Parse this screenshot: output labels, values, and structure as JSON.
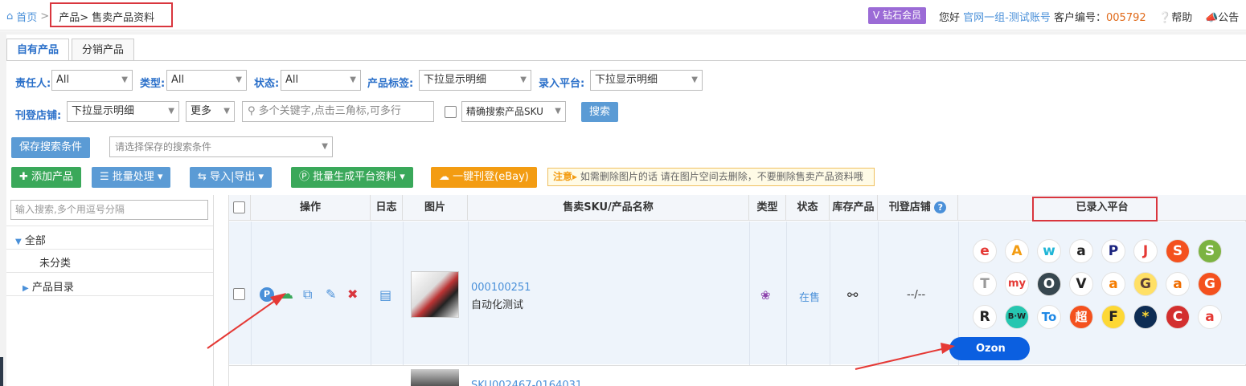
{
  "breadcrumb": {
    "home": "首页",
    "sep": ">",
    "product": "产品>",
    "current": "售卖产品资料"
  },
  "header": {
    "vip": "钻石会员",
    "greet": "您好",
    "account": "官网一组-测试账号",
    "customer_label": "客户编号：",
    "customer_no": "005792",
    "help": "帮助",
    "notice": "公告"
  },
  "tabs": [
    "自有产品",
    "分销产品"
  ],
  "filters": {
    "owner_label": "责任人:",
    "owner_value": "All",
    "type_label": "类型:",
    "type_value": "All",
    "status_label": "状态:",
    "status_value": "All",
    "tag_label": "产品标签:",
    "tag_value": "下拉显示明细",
    "platform_label": "录入平台:",
    "platform_value": "下拉显示明细",
    "shop_label": "刊登店铺:",
    "shop_value": "下拉显示明细",
    "more_value": "更多",
    "keyword_placeholder": "多个关键字,点击三角标,可多行",
    "exact_label": "精确搜索产品SKU",
    "search_button": "搜索",
    "save_button": "保存搜索条件",
    "saved_placeholder": "请选择保存的搜索条件"
  },
  "toolbar": {
    "add": "添加产品",
    "batch": "批量处理",
    "io": "导入|导出",
    "gen": "批量生成平台资料",
    "publish": "一键刊登(eBay)",
    "tip_label": "注意",
    "tip_text": "如需删除图片的话 请在图片空间去删除，不要删除售卖产品资料哦"
  },
  "sidebar": {
    "search_placeholder": "输入搜索,多个用逗号分隔",
    "all": "全部",
    "uncategorized": "未分类",
    "catalog": "产品目录"
  },
  "table": {
    "headers": [
      "操作",
      "日志",
      "图片",
      "售卖SKU/产品名称",
      "类型",
      "状态",
      "库存产品",
      "刊登店铺",
      "已录入平台"
    ],
    "rows": [
      {
        "sku": "000100251",
        "name": "自动化测试",
        "status": "在售",
        "shops": "--/--"
      },
      {
        "sku": "SKU002467-0164031"
      }
    ]
  },
  "platforms": [
    "e",
    "A",
    "w",
    "a",
    "P",
    "J",
    "S",
    "S",
    "T",
    "my",
    "O",
    "V",
    "a",
    "G",
    "a",
    "G",
    "R",
    "B·W",
    "To",
    "超",
    "F",
    "*",
    "C",
    "a"
  ],
  "ozon": "Ozon",
  "colors": {
    "accent": "#2a6fc9",
    "highlight": "#d9363e"
  }
}
